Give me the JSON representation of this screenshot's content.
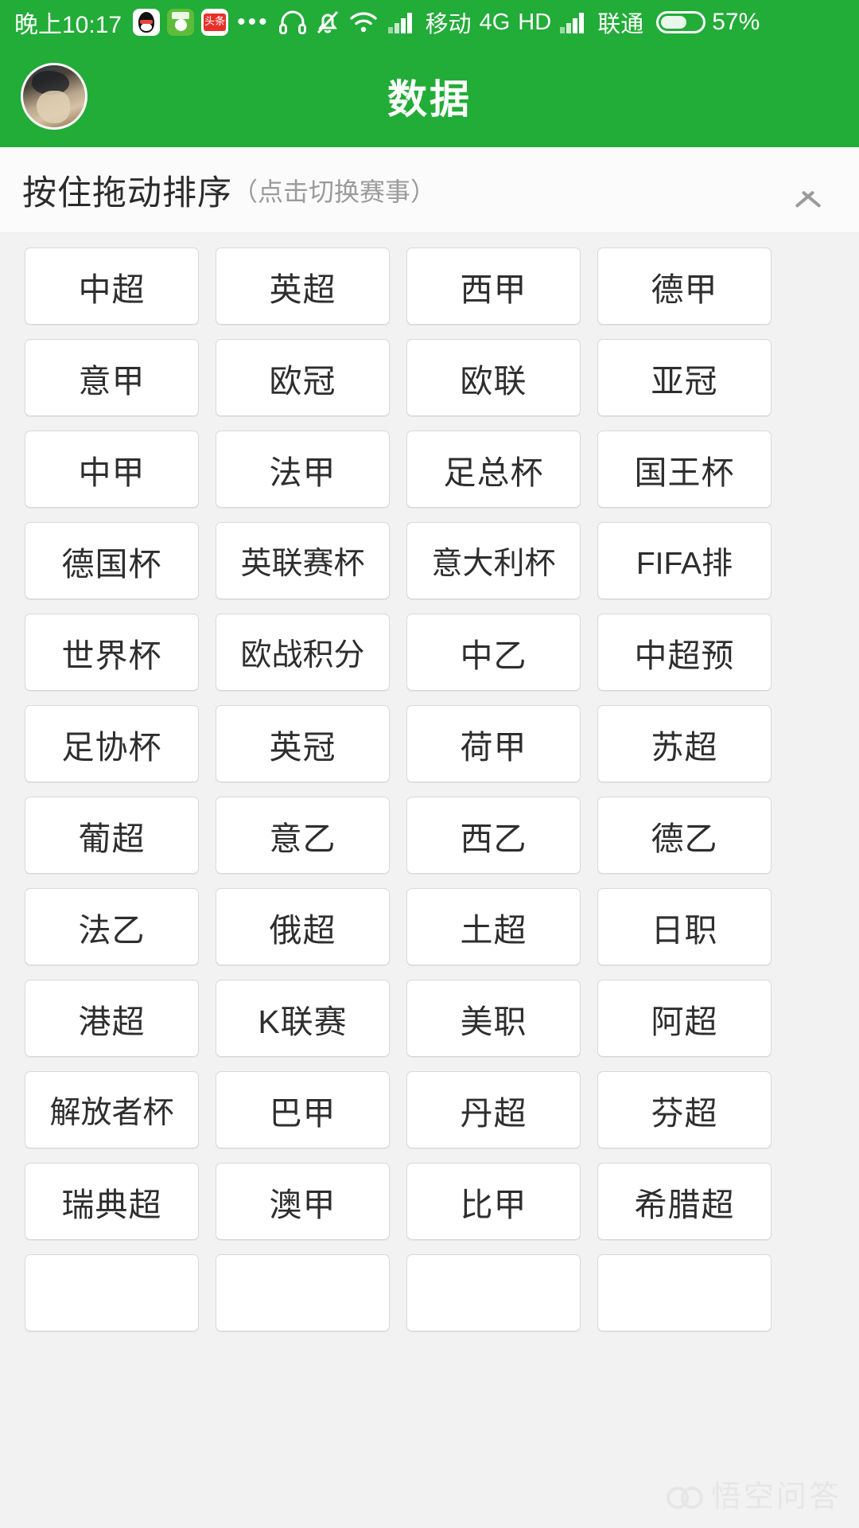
{
  "status_bar": {
    "time": "晚上10:17",
    "app_icons": [
      "qq-icon",
      "football-app-icon",
      "toutiao-icon"
    ],
    "overflow": "•••",
    "icons": [
      "headset-icon",
      "bell-muted-icon",
      "wifi-icon",
      "signal-icon"
    ],
    "carrier_primary": "移动",
    "network": "4G",
    "hd": "HD",
    "carrier_secondary": "联通",
    "battery_percent": "57%",
    "battery_level": 57
  },
  "app_bar": {
    "title": "数据",
    "avatar": "user-avatar"
  },
  "section": {
    "title": "按住拖动排序",
    "subtitle": "（点击切换赛事）",
    "collapse_icon": "chevron-up-icon"
  },
  "leagues": [
    "中超",
    "英超",
    "西甲",
    "德甲",
    "意甲",
    "欧冠",
    "欧联",
    "亚冠",
    "中甲",
    "法甲",
    "足总杯",
    "国王杯",
    "德国杯",
    "英联赛杯",
    "意大利杯",
    "FIFA排",
    "世界杯",
    "欧战积分",
    "中乙",
    "中超预",
    "足协杯",
    "英冠",
    "荷甲",
    "苏超",
    "葡超",
    "意乙",
    "西乙",
    "德乙",
    "法乙",
    "俄超",
    "土超",
    "日职",
    "港超",
    "K联赛",
    "美职",
    "阿超",
    "解放者杯",
    "巴甲",
    "丹超",
    "芬超",
    "瑞典超",
    "澳甲",
    "比甲",
    "希腊超",
    "",
    "",
    "",
    ""
  ],
  "watermark": {
    "text": "悟空问答",
    "logo": "wukong-logo-icon"
  },
  "colors": {
    "brand_green": "#22ac38",
    "page_background": "#f2f2f2",
    "chip_background": "#ffffff",
    "chip_border": "#d9d9d9",
    "text_primary": "#2e2e2e",
    "text_muted": "#9b9b9b"
  }
}
